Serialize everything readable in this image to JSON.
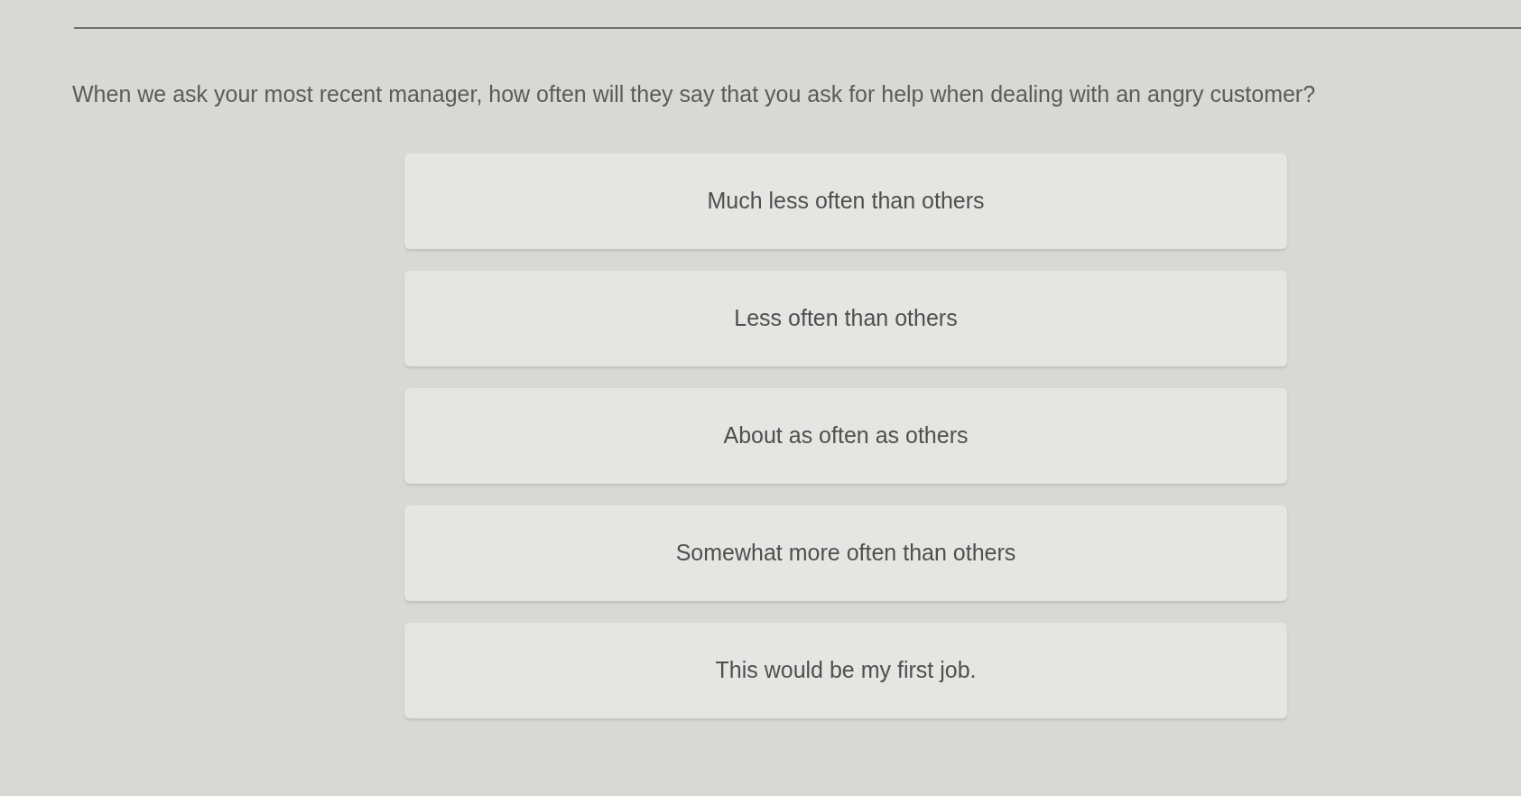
{
  "question": {
    "text": "When we ask your most recent manager, how often will they say that you ask for help when dealing with an angry customer?"
  },
  "options": [
    {
      "label": "Much less often than others",
      "selected": false
    },
    {
      "label": "Less often than others",
      "selected": false
    },
    {
      "label": "About as often as others",
      "selected": false
    },
    {
      "label": "Somewhat more often than others",
      "selected": false
    },
    {
      "label": "This would be my first job.",
      "selected": false
    }
  ]
}
